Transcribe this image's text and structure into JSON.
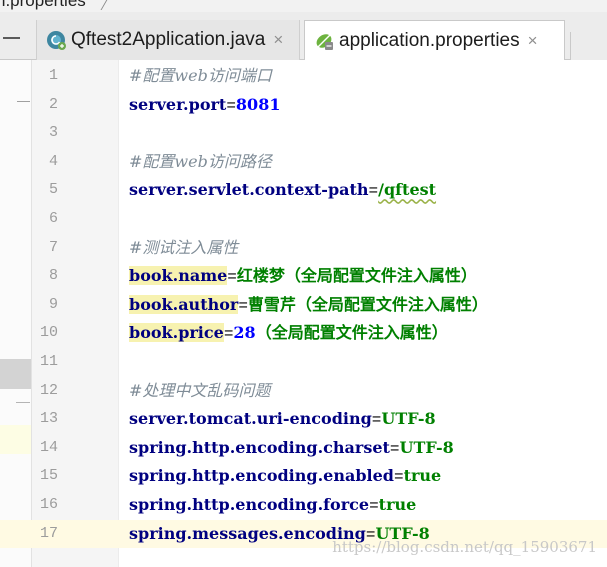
{
  "breadcrumb": {
    "text": "n.properties"
  },
  "tabs": [
    {
      "label": "Qftest2Application.java",
      "close": "×",
      "active": false,
      "icon": "java-class-icon"
    },
    {
      "label": "application.properties",
      "close": "×",
      "active": true,
      "icon": "spring-leaf-icon"
    }
  ],
  "colors": {
    "comment": "#7f8c97",
    "key": "#000080",
    "value": "#008000",
    "number": "#0000ff",
    "current_line": "#fffae3",
    "highlight": "#f7f2b0"
  },
  "lines": [
    {
      "n": "1",
      "comment": "#配置web访问端口"
    },
    {
      "n": "2",
      "key": "server.port",
      "eq": "=",
      "num": "8081"
    },
    {
      "n": "3"
    },
    {
      "n": "4",
      "comment": "#配置web访问路径"
    },
    {
      "n": "5",
      "key": "server.servlet.context-path",
      "eq": "=",
      "val": "/qftest"
    },
    {
      "n": "6"
    },
    {
      "n": "7",
      "comment": "#测试注入属性"
    },
    {
      "n": "8",
      "key": "book.name",
      "eq": "=",
      "val": "红楼梦（全局配置文件注入属性）"
    },
    {
      "n": "9",
      "key": "book.author",
      "eq": "=",
      "val": "曹雪芹（全局配置文件注入属性）"
    },
    {
      "n": "10",
      "key": "book.price",
      "eq": "=",
      "num": "28",
      "val": "（全局配置文件注入属性）"
    },
    {
      "n": "11"
    },
    {
      "n": "12",
      "comment": "#处理中文乱码问题"
    },
    {
      "n": "13",
      "key": "server.tomcat.uri-encoding",
      "eq": "=",
      "val": "UTF-8"
    },
    {
      "n": "14",
      "key": "spring.http.encoding.charset",
      "eq": "=",
      "val": "UTF-8"
    },
    {
      "n": "15",
      "key": "spring.http.encoding.enabled",
      "eq": "=",
      "val": "true"
    },
    {
      "n": "16",
      "key": "spring.http.encoding.force",
      "eq": "=",
      "val": "true"
    },
    {
      "n": "17",
      "key": "spring.messages.encoding",
      "eq": "=",
      "val": "UTF-8",
      "current": true
    }
  ],
  "watermark": "https://blog.csdn.net/qq_15903671"
}
